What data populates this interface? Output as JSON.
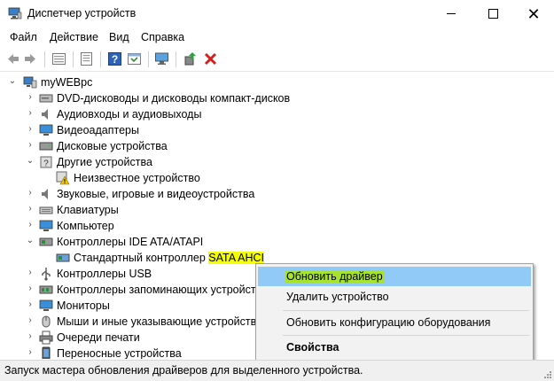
{
  "window": {
    "title": "Диспетчер устройств"
  },
  "menu": [
    "Файл",
    "Действие",
    "Вид",
    "Справка"
  ],
  "tree": {
    "root": "myWEBpc",
    "items": [
      "DVD-дисководы и дисководы компакт-дисков",
      "Аудиовходы и аудиовыходы",
      "Видеоадаптеры",
      "Дисковые устройства",
      "Другие устройства",
      "Неизвестное устройство",
      "Звуковые, игровые и видеоустройства",
      "Клавиатуры",
      "Компьютер",
      "Контроллеры IDE ATA/ATAPI",
      "Стандартный контроллер ",
      "Контроллеры USB",
      "Контроллеры запоминающих устройств",
      "Мониторы",
      "Мыши и иные указывающие устройства",
      "Очереди печати",
      "Переносные устройства"
    ],
    "selected_highlight": "SATA AHCI"
  },
  "context_menu": {
    "items": [
      "Обновить драйвер",
      "Удалить устройство",
      "Обновить конфигурацию оборудования",
      "Свойства"
    ]
  },
  "status": "Запуск мастера обновления драйверов для выделенного устройства.",
  "colors": {
    "selection": "#cce8ff",
    "menu_active": "#91c9f7",
    "highlight_yellow": "#f6ff00",
    "highlight_green": "#a6e22e"
  }
}
